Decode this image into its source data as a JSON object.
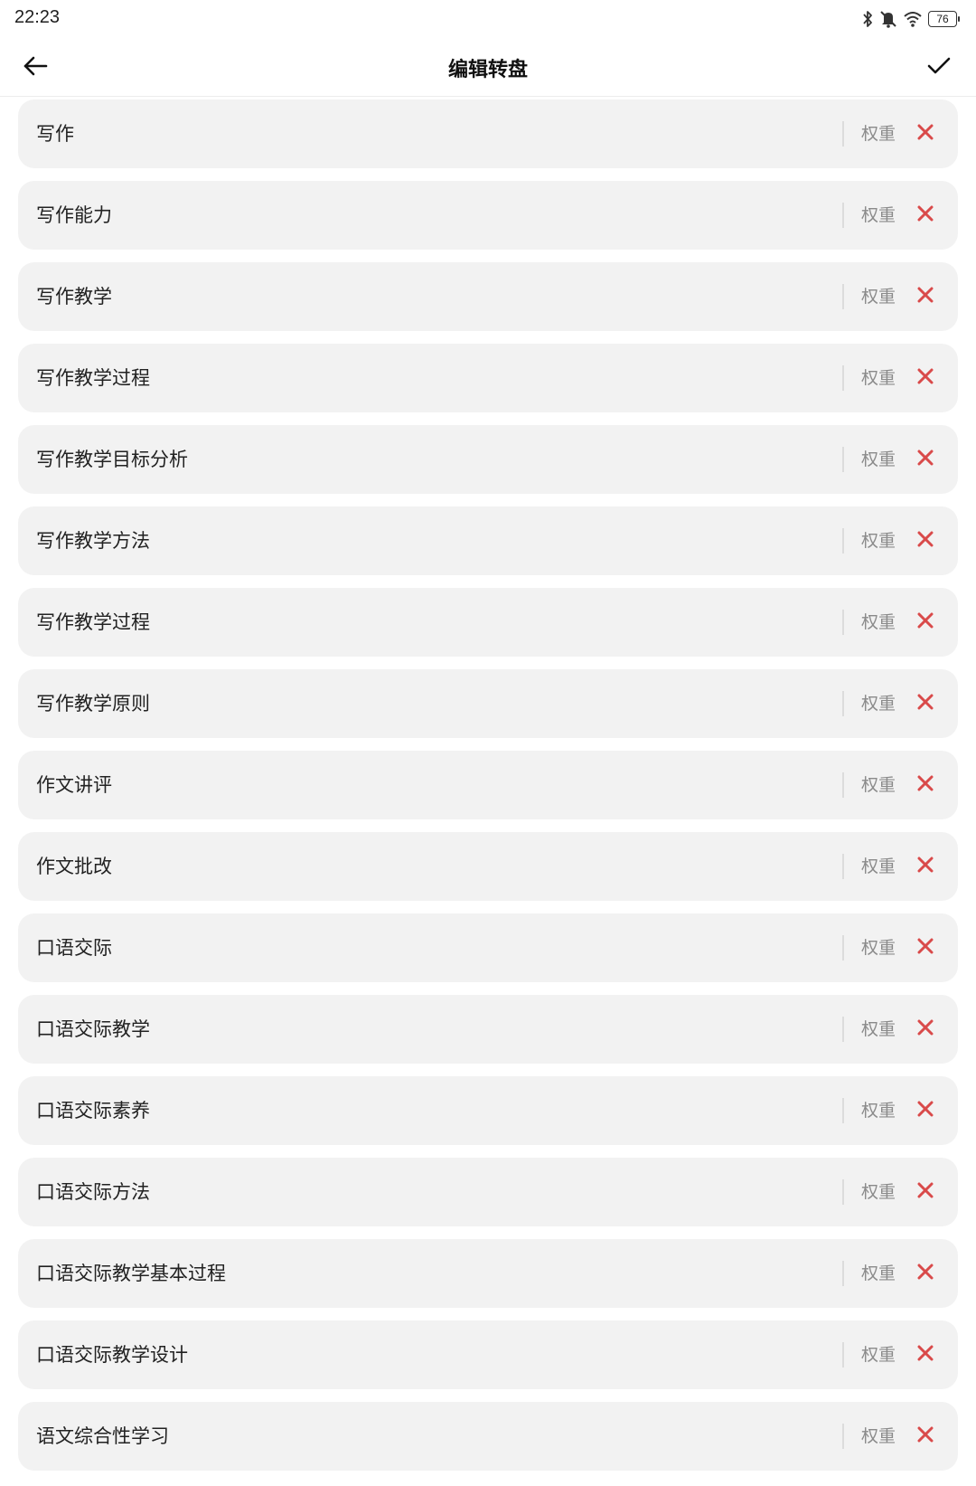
{
  "status_bar": {
    "time": "22:23",
    "battery_level": "76",
    "icons": [
      "bluetooth-icon",
      "mute-bell-icon",
      "wifi-icon",
      "battery-icon"
    ]
  },
  "header": {
    "title": "编辑转盘",
    "back_icon": "arrow-left-icon",
    "confirm_icon": "checkmark-icon"
  },
  "colors": {
    "delete": "#d94a4a",
    "item_bg": "#f2f2f2",
    "weight_text": "#8a8a8a"
  },
  "items": [
    {
      "label": "写作",
      "weight_label": "权重"
    },
    {
      "label": "写作能力",
      "weight_label": "权重"
    },
    {
      "label": "写作教学",
      "weight_label": "权重"
    },
    {
      "label": "写作教学过程",
      "weight_label": "权重"
    },
    {
      "label": "写作教学目标分析",
      "weight_label": "权重"
    },
    {
      "label": "写作教学方法",
      "weight_label": "权重"
    },
    {
      "label": "写作教学过程",
      "weight_label": "权重"
    },
    {
      "label": "写作教学原则",
      "weight_label": "权重"
    },
    {
      "label": "作文讲评",
      "weight_label": "权重"
    },
    {
      "label": "作文批改",
      "weight_label": "权重"
    },
    {
      "label": "口语交际",
      "weight_label": "权重"
    },
    {
      "label": "口语交际教学",
      "weight_label": "权重"
    },
    {
      "label": "口语交际素养",
      "weight_label": "权重"
    },
    {
      "label": "口语交际方法",
      "weight_label": "权重"
    },
    {
      "label": "口语交际教学基本过程",
      "weight_label": "权重"
    },
    {
      "label": "口语交际教学设计",
      "weight_label": "权重"
    },
    {
      "label": "语文综合性学习",
      "weight_label": "权重"
    }
  ]
}
